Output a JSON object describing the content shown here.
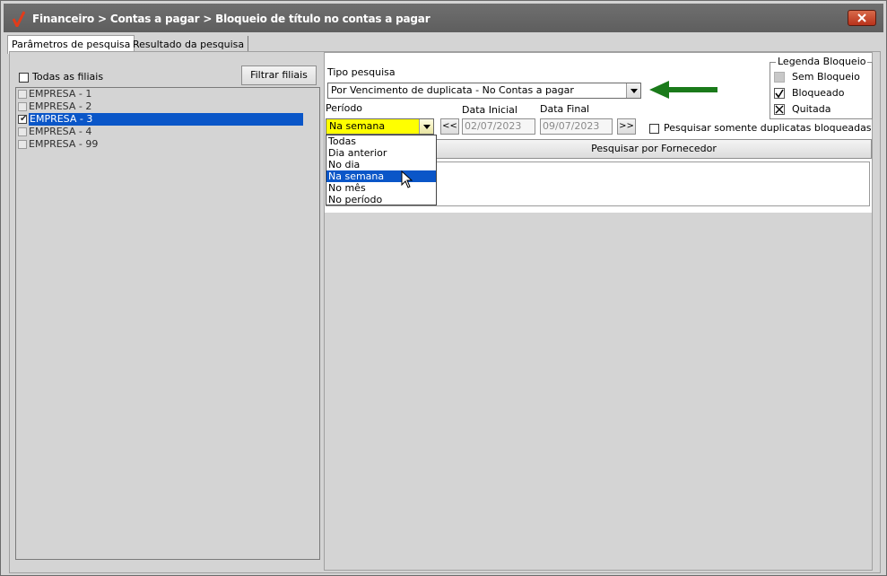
{
  "window": {
    "title": "Financeiro > Contas a pagar > Bloqueio de título no contas a pagar"
  },
  "tabs": [
    {
      "label": "Parâmetros de pesquisa",
      "active": true
    },
    {
      "label": "Resultado da pesquisa",
      "active": false
    }
  ],
  "left": {
    "all_branches_label": "Todas as filiais",
    "filter_button": "Filtrar filiais",
    "companies": [
      {
        "label": "EMPRESA - 1",
        "checked": false,
        "selected": false
      },
      {
        "label": "EMPRESA - 2",
        "checked": false,
        "selected": false
      },
      {
        "label": "EMPRESA - 3",
        "checked": true,
        "selected": true
      },
      {
        "label": "EMPRESA - 4",
        "checked": false,
        "selected": false
      },
      {
        "label": "EMPRESA - 99",
        "checked": false,
        "selected": false
      }
    ]
  },
  "form": {
    "tipo_label": "Tipo pesquisa",
    "tipo_value": "Por Vencimento de duplicata - No Contas a pagar",
    "periodo_label": "Período",
    "periodo_value": "Na semana",
    "periodo_options": [
      "Todas",
      "Dia anterior",
      "No dia",
      "Na semana",
      "No mês",
      "No período"
    ],
    "periodo_selected_index": 3,
    "prev_button": "<<",
    "next_button": ">>",
    "data_inicial_label": "Data Inicial",
    "data_inicial_value": "02/07/2023",
    "data_final_label": "Data Final",
    "data_final_value": "09/07/2023",
    "somente_label": "Pesquisar somente duplicatas bloqueadas",
    "pesquisar_button": "Pesquisar por Fornecedor"
  },
  "legend": {
    "title": "Legenda Bloqueio",
    "items": [
      {
        "label": "Sem Bloqueio"
      },
      {
        "label": "Bloqueado"
      },
      {
        "label": "Quitada"
      }
    ]
  },
  "colors": {
    "titlebar": "#626262",
    "selection": "#0a56c8",
    "highlight_yellow": "#ffff00",
    "annotation_arrow": "#1a7a1a",
    "close_button": "#c44a2a"
  }
}
